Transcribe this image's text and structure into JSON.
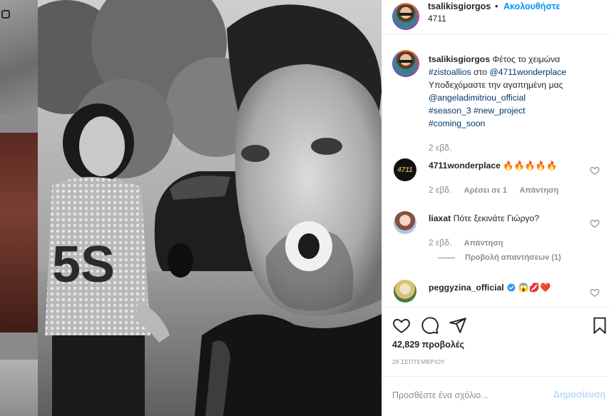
{
  "post": {
    "username": "tsalikisgiorgos",
    "dot": "•",
    "follow_label": "Ακολουθήστε",
    "location": "4711"
  },
  "caption": {
    "username": "tsalikisgiorgos",
    "text": "Φέτος το χειμώνα",
    "hashtag1": "#zistoallios",
    "middle": "στο",
    "mention1": "@4711wonderplace",
    "line2": "Υποδεχόμαστε την αγαπημένη μας",
    "mention2": "@angeladimitriou_official",
    "hashtag2": "#season_3",
    "hashtag3": "#new_project",
    "hashtag4": "#coming_soon",
    "time": "2 εβδ."
  },
  "comments": [
    {
      "username": "4711wonderplace",
      "text": "🔥🔥🔥🔥🔥",
      "avatar_text": "4711",
      "time": "2 εβδ.",
      "likes": "Αρέσει σε 1",
      "reply": "Απάντηση"
    },
    {
      "username": "liaxat",
      "text": "Πότε ξεκινάτε Γιώργο?",
      "time": "2 εβδ.",
      "reply": "Απάντηση",
      "view_replies": "Προβολή απαντήσεων (1)"
    },
    {
      "username": "peggyzina_official",
      "verified": true,
      "text": "😱💋❤️"
    }
  ],
  "stats": {
    "views": "42,829 προβολές",
    "date": "28 ΣΕΠΤΕΜΒΡΙΟΥ"
  },
  "composer": {
    "placeholder": "Προσθέστε ένα σχόλιο...",
    "post_label": "Δημοσίευση"
  },
  "colors": {
    "link_blue": "#0095f6",
    "tag_blue": "#00376b",
    "muted": "#8e8e8e",
    "post_disabled": "#b3dbff",
    "verified": "#3897f0"
  },
  "icons": [
    "heart-icon",
    "comment-icon",
    "share-icon",
    "bookmark-icon",
    "verified-icon"
  ]
}
